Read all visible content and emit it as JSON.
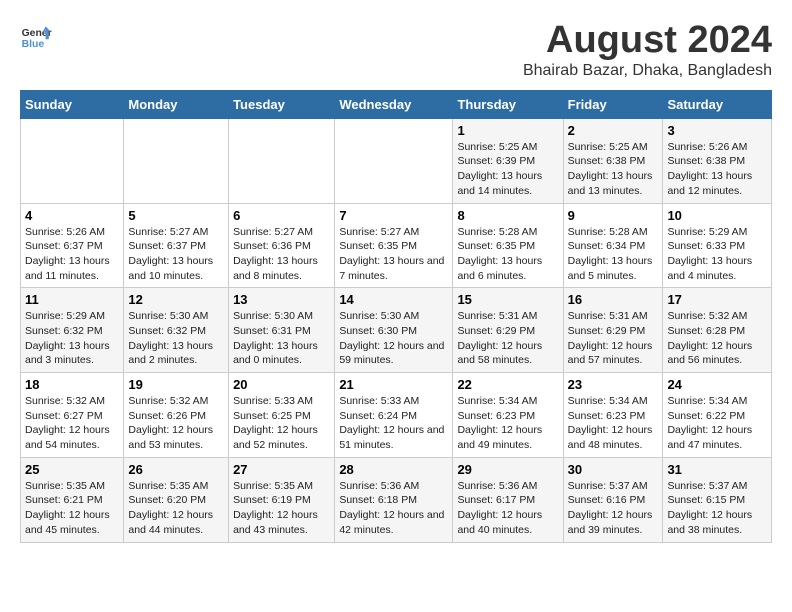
{
  "header": {
    "logo_line1": "General",
    "logo_line2": "Blue",
    "month_year": "August 2024",
    "location": "Bhairab Bazar, Dhaka, Bangladesh"
  },
  "weekdays": [
    "Sunday",
    "Monday",
    "Tuesday",
    "Wednesday",
    "Thursday",
    "Friday",
    "Saturday"
  ],
  "weeks": [
    [
      {
        "day": "",
        "sunrise": "",
        "sunset": "",
        "daylight": ""
      },
      {
        "day": "",
        "sunrise": "",
        "sunset": "",
        "daylight": ""
      },
      {
        "day": "",
        "sunrise": "",
        "sunset": "",
        "daylight": ""
      },
      {
        "day": "",
        "sunrise": "",
        "sunset": "",
        "daylight": ""
      },
      {
        "day": "1",
        "sunrise": "Sunrise: 5:25 AM",
        "sunset": "Sunset: 6:39 PM",
        "daylight": "Daylight: 13 hours and 14 minutes."
      },
      {
        "day": "2",
        "sunrise": "Sunrise: 5:25 AM",
        "sunset": "Sunset: 6:38 PM",
        "daylight": "Daylight: 13 hours and 13 minutes."
      },
      {
        "day": "3",
        "sunrise": "Sunrise: 5:26 AM",
        "sunset": "Sunset: 6:38 PM",
        "daylight": "Daylight: 13 hours and 12 minutes."
      }
    ],
    [
      {
        "day": "4",
        "sunrise": "Sunrise: 5:26 AM",
        "sunset": "Sunset: 6:37 PM",
        "daylight": "Daylight: 13 hours and 11 minutes."
      },
      {
        "day": "5",
        "sunrise": "Sunrise: 5:27 AM",
        "sunset": "Sunset: 6:37 PM",
        "daylight": "Daylight: 13 hours and 10 minutes."
      },
      {
        "day": "6",
        "sunrise": "Sunrise: 5:27 AM",
        "sunset": "Sunset: 6:36 PM",
        "daylight": "Daylight: 13 hours and 8 minutes."
      },
      {
        "day": "7",
        "sunrise": "Sunrise: 5:27 AM",
        "sunset": "Sunset: 6:35 PM",
        "daylight": "Daylight: 13 hours and 7 minutes."
      },
      {
        "day": "8",
        "sunrise": "Sunrise: 5:28 AM",
        "sunset": "Sunset: 6:35 PM",
        "daylight": "Daylight: 13 hours and 6 minutes."
      },
      {
        "day": "9",
        "sunrise": "Sunrise: 5:28 AM",
        "sunset": "Sunset: 6:34 PM",
        "daylight": "Daylight: 13 hours and 5 minutes."
      },
      {
        "day": "10",
        "sunrise": "Sunrise: 5:29 AM",
        "sunset": "Sunset: 6:33 PM",
        "daylight": "Daylight: 13 hours and 4 minutes."
      }
    ],
    [
      {
        "day": "11",
        "sunrise": "Sunrise: 5:29 AM",
        "sunset": "Sunset: 6:32 PM",
        "daylight": "Daylight: 13 hours and 3 minutes."
      },
      {
        "day": "12",
        "sunrise": "Sunrise: 5:30 AM",
        "sunset": "Sunset: 6:32 PM",
        "daylight": "Daylight: 13 hours and 2 minutes."
      },
      {
        "day": "13",
        "sunrise": "Sunrise: 5:30 AM",
        "sunset": "Sunset: 6:31 PM",
        "daylight": "Daylight: 13 hours and 0 minutes."
      },
      {
        "day": "14",
        "sunrise": "Sunrise: 5:30 AM",
        "sunset": "Sunset: 6:30 PM",
        "daylight": "Daylight: 12 hours and 59 minutes."
      },
      {
        "day": "15",
        "sunrise": "Sunrise: 5:31 AM",
        "sunset": "Sunset: 6:29 PM",
        "daylight": "Daylight: 12 hours and 58 minutes."
      },
      {
        "day": "16",
        "sunrise": "Sunrise: 5:31 AM",
        "sunset": "Sunset: 6:29 PM",
        "daylight": "Daylight: 12 hours and 57 minutes."
      },
      {
        "day": "17",
        "sunrise": "Sunrise: 5:32 AM",
        "sunset": "Sunset: 6:28 PM",
        "daylight": "Daylight: 12 hours and 56 minutes."
      }
    ],
    [
      {
        "day": "18",
        "sunrise": "Sunrise: 5:32 AM",
        "sunset": "Sunset: 6:27 PM",
        "daylight": "Daylight: 12 hours and 54 minutes."
      },
      {
        "day": "19",
        "sunrise": "Sunrise: 5:32 AM",
        "sunset": "Sunset: 6:26 PM",
        "daylight": "Daylight: 12 hours and 53 minutes."
      },
      {
        "day": "20",
        "sunrise": "Sunrise: 5:33 AM",
        "sunset": "Sunset: 6:25 PM",
        "daylight": "Daylight: 12 hours and 52 minutes."
      },
      {
        "day": "21",
        "sunrise": "Sunrise: 5:33 AM",
        "sunset": "Sunset: 6:24 PM",
        "daylight": "Daylight: 12 hours and 51 minutes."
      },
      {
        "day": "22",
        "sunrise": "Sunrise: 5:34 AM",
        "sunset": "Sunset: 6:23 PM",
        "daylight": "Daylight: 12 hours and 49 minutes."
      },
      {
        "day": "23",
        "sunrise": "Sunrise: 5:34 AM",
        "sunset": "Sunset: 6:23 PM",
        "daylight": "Daylight: 12 hours and 48 minutes."
      },
      {
        "day": "24",
        "sunrise": "Sunrise: 5:34 AM",
        "sunset": "Sunset: 6:22 PM",
        "daylight": "Daylight: 12 hours and 47 minutes."
      }
    ],
    [
      {
        "day": "25",
        "sunrise": "Sunrise: 5:35 AM",
        "sunset": "Sunset: 6:21 PM",
        "daylight": "Daylight: 12 hours and 45 minutes."
      },
      {
        "day": "26",
        "sunrise": "Sunrise: 5:35 AM",
        "sunset": "Sunset: 6:20 PM",
        "daylight": "Daylight: 12 hours and 44 minutes."
      },
      {
        "day": "27",
        "sunrise": "Sunrise: 5:35 AM",
        "sunset": "Sunset: 6:19 PM",
        "daylight": "Daylight: 12 hours and 43 minutes."
      },
      {
        "day": "28",
        "sunrise": "Sunrise: 5:36 AM",
        "sunset": "Sunset: 6:18 PM",
        "daylight": "Daylight: 12 hours and 42 minutes."
      },
      {
        "day": "29",
        "sunrise": "Sunrise: 5:36 AM",
        "sunset": "Sunset: 6:17 PM",
        "daylight": "Daylight: 12 hours and 40 minutes."
      },
      {
        "day": "30",
        "sunrise": "Sunrise: 5:37 AM",
        "sunset": "Sunset: 6:16 PM",
        "daylight": "Daylight: 12 hours and 39 minutes."
      },
      {
        "day": "31",
        "sunrise": "Sunrise: 5:37 AM",
        "sunset": "Sunset: 6:15 PM",
        "daylight": "Daylight: 12 hours and 38 minutes."
      }
    ]
  ]
}
